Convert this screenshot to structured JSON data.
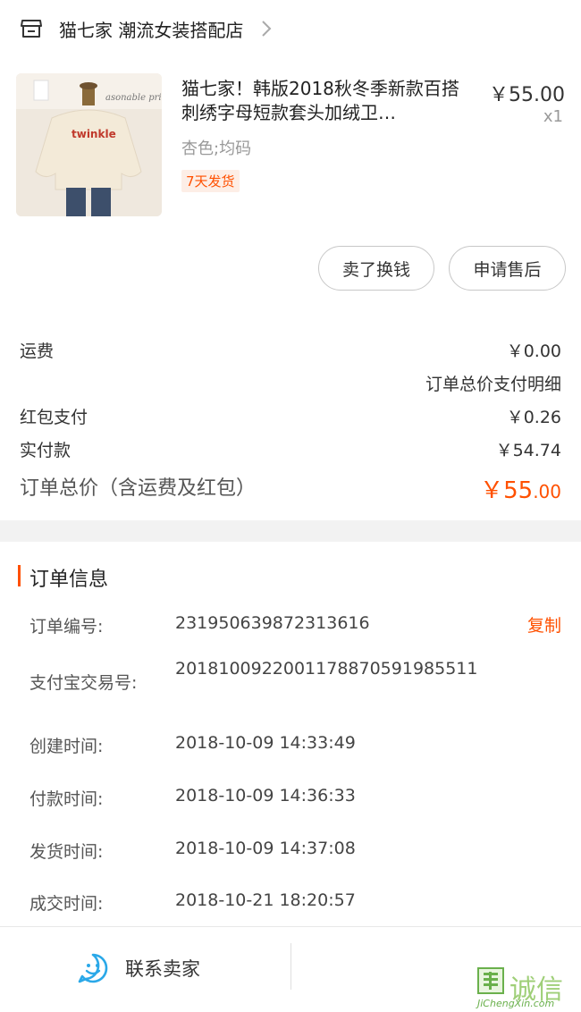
{
  "store": {
    "name": "猫七家 潮流女装搭配店"
  },
  "product": {
    "title": "猫七家！韩版2018秋冬季新款百搭刺绣字母短款套头加绒卫…",
    "price": "￥55.00",
    "quantity": "x1",
    "sku": "杏色;均码",
    "badge": "7天发货",
    "image_text": {
      "sweater_print": "twinkle",
      "sign": "asonable price"
    }
  },
  "actions": {
    "sell_label": "卖了换钱",
    "after_sale_label": "申请售后"
  },
  "costs": {
    "shipping_label": "运费",
    "shipping_value": "￥0.00",
    "detail_link": "订单总价支付明细",
    "redpacket_label": "红包支付",
    "redpacket_value": "￥0.26",
    "paid_label": "实付款",
    "paid_value": "￥54.74",
    "total_label": "订单总价（含运费及红包）",
    "total_main": "￥55",
    "total_cents": ".00"
  },
  "order_info": {
    "title": "订单信息",
    "copy_label": "复制",
    "rows": [
      {
        "label": "订单编号:",
        "value": "231950639872313616"
      },
      {
        "label": "支付宝交易号:",
        "value": "2018100922001178870591985511"
      },
      {
        "label": "创建时间:",
        "value": "2018-10-09 14:33:49"
      },
      {
        "label": "付款时间:",
        "value": "2018-10-09 14:36:33"
      },
      {
        "label": "发货时间:",
        "value": "2018-10-09 14:37:08"
      },
      {
        "label": "成交时间:",
        "value": "2018-10-21 18:20:57"
      }
    ]
  },
  "bottom": {
    "contact_label": "联系卖家"
  },
  "watermark": {
    "text": "诚信",
    "url": "JiChengXin.com"
  },
  "colors": {
    "accent": "#ff5000",
    "contact_icon": "#2aa8e8",
    "watermark": "#9fcf78"
  },
  "icons": {
    "store": "store-icon",
    "chevron": "chevron-right-icon",
    "contact": "smiley-chat-icon"
  }
}
